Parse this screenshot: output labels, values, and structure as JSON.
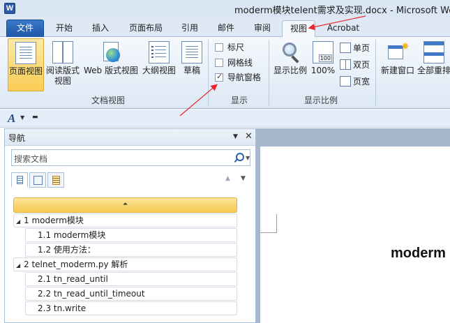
{
  "window": {
    "title": "moderm模块telent需求及实现.docx - Microsoft Word",
    "app_icon_letter": "W"
  },
  "ribbon_tabs": [
    {
      "label": "文件"
    },
    {
      "label": "开始"
    },
    {
      "label": "插入"
    },
    {
      "label": "页面布局"
    },
    {
      "label": "引用"
    },
    {
      "label": "邮件"
    },
    {
      "label": "审阅"
    },
    {
      "label": "视图"
    },
    {
      "label": "Acrobat"
    }
  ],
  "ribbon": {
    "doc_views": {
      "group_label": "文档视图",
      "buttons": [
        {
          "label": "页面视图",
          "active": true
        },
        {
          "label": "阅读版式\n视图"
        },
        {
          "label": "Web 版式视图"
        },
        {
          "label": "大纲视图"
        },
        {
          "label": "草稿"
        }
      ]
    },
    "show": {
      "group_label": "显示",
      "checkboxes": [
        {
          "label": "标尺",
          "checked": false
        },
        {
          "label": "网格线",
          "checked": false
        },
        {
          "label": "导航窗格",
          "checked": true
        }
      ]
    },
    "zoom": {
      "group_label": "显示比例",
      "zoom_label": "显示比例",
      "percent_label": "100%",
      "percent_icon_text": "100",
      "single_page": "单页",
      "two_pages": "双页",
      "page_width": "页宽"
    },
    "window": {
      "new_window": "新建窗口",
      "arrange_all": "全部重排"
    }
  },
  "quick_toolbar": {
    "font_glyph": "A"
  },
  "nav_pane": {
    "title": "导航",
    "search_placeholder": "搜索文档",
    "headings": [
      {
        "level": 1,
        "text": "1 moderm模块"
      },
      {
        "level": 2,
        "text": "1.1 moderm模块"
      },
      {
        "level": 2,
        "text": "1.2 使用方法："
      },
      {
        "level": 1,
        "text": "2 telnet_moderm.py 解析"
      },
      {
        "level": 2,
        "text": "2.1 tn_read_until"
      },
      {
        "level": 2,
        "text": "2.2 tn_read_until_timeout"
      },
      {
        "level": 2,
        "text": "2.3 tn.write"
      }
    ]
  },
  "document": {
    "visible_heading": "moderm"
  },
  "colors": {
    "file_tab": "#2b68b8",
    "active_button": "#f9cc55",
    "heading_bar": "#f7c94e",
    "annotation_arrow": "#e8262b"
  }
}
